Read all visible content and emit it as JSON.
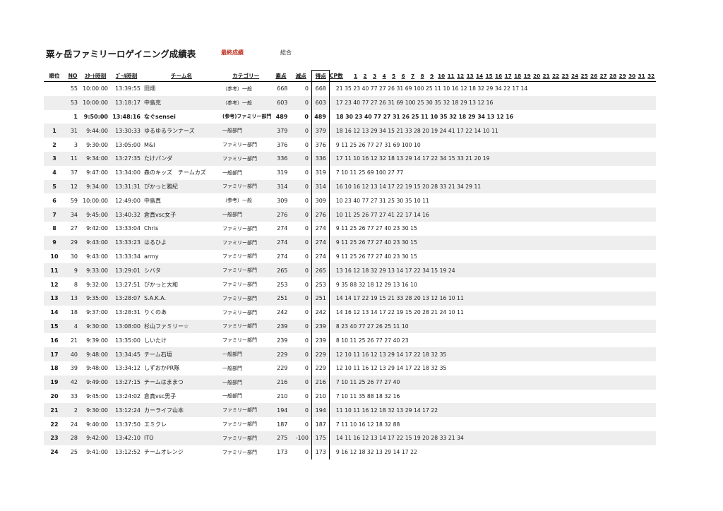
{
  "header": {
    "title": "粟ヶ岳ファミリーロゲイニング成績表",
    "label_final": "最終成績",
    "label_overall": "総合"
  },
  "columns": {
    "rank": "順位",
    "no": "NO",
    "start": "ｽﾀｰﾄ時刻",
    "goal": "ｺﾞｰﾙ時刻",
    "team": "チーム名",
    "category": "カテゴリー",
    "raw": "素点",
    "penalty": "減点",
    "score": "得点",
    "cp_count": "CP数",
    "cp_numbers": [
      "1",
      "2",
      "3",
      "4",
      "5",
      "6",
      "7",
      "8",
      "9",
      "10",
      "11",
      "12",
      "13",
      "14",
      "15",
      "16",
      "17",
      "18",
      "19",
      "20",
      "21",
      "22",
      "23",
      "24",
      "25",
      "26",
      "27",
      "28",
      "29",
      "30",
      "31",
      "32"
    ]
  },
  "rows": [
    {
      "rank": "",
      "no": "55",
      "start": "10:00:00",
      "goal": "13:39:55",
      "team": "田畑",
      "category": "（参考）一般",
      "raw": "668",
      "penalty": "0",
      "score": "668",
      "cps": "21 35 23 40 77 27 26 31 69 100 25 11 10 16 12 18 32 29 34 22 17 14",
      "bold": false
    },
    {
      "rank": "",
      "no": "53",
      "start": "10:00:00",
      "goal": "13:18:17",
      "team": "中島克",
      "category": "（参考）一般",
      "raw": "603",
      "penalty": "0",
      "score": "603",
      "cps": "17 23 40 77 27 26 31 69 100 25 30 35 32 18 29 13 12 16",
      "bold": false
    },
    {
      "rank": "",
      "no": "1",
      "start": "9:50:00",
      "goal": "13:48:16",
      "team": "なぐsensei",
      "category": "(参考)ファミリー部門",
      "raw": "489",
      "penalty": "0",
      "score": "489",
      "cps": "18 30 23 40 77 27 31 26 25 11 10 35 32 18 29 34 13 12 16",
      "bold": true
    },
    {
      "rank": "1",
      "no": "31",
      "start": "9:44:00",
      "goal": "13:30:33",
      "team": "ゆるゆるランナーズ",
      "category": "一般部門",
      "raw": "379",
      "penalty": "0",
      "score": "379",
      "cps": "18 16 12 13 29 34 15 21 33 28 20 19 24 41 17 22 14 10 11",
      "bold": false
    },
    {
      "rank": "2",
      "no": "3",
      "start": "9:30:00",
      "goal": "13:05:00",
      "team": "M&I",
      "category": "ファミリー部門",
      "raw": "376",
      "penalty": "0",
      "score": "376",
      "cps": "9 11 25 26 77 27 31 69 100 10",
      "bold": false
    },
    {
      "rank": "3",
      "no": "11",
      "start": "9:34:00",
      "goal": "13:27:35",
      "team": "たけパンダ",
      "category": "ファミリー部門",
      "raw": "336",
      "penalty": "0",
      "score": "336",
      "cps": "17 11 10 16 12 32 18 13 29 14 17 22 34 15 33 21 20 19",
      "bold": false
    },
    {
      "rank": "4",
      "no": "37",
      "start": "9:47:00",
      "goal": "13:34:00",
      "team": "森のキッズ　チームカズ",
      "category": "一般部門",
      "raw": "319",
      "penalty": "0",
      "score": "319",
      "cps": "7 10 11 25 69 100 27 77",
      "bold": false
    },
    {
      "rank": "5",
      "no": "12",
      "start": "9:34:00",
      "goal": "13:31:31",
      "team": "ぴかっと雅紀",
      "category": "ファミリー部門",
      "raw": "314",
      "penalty": "0",
      "score": "314",
      "cps": "16 10 16 12 13 14 17 22 19 15 20 28 33 21 34 29 11",
      "bold": false
    },
    {
      "rank": "6",
      "no": "59",
      "start": "10:00:00",
      "goal": "12:49:00",
      "team": "中島真",
      "category": "（参考）一般",
      "raw": "309",
      "penalty": "0",
      "score": "309",
      "cps": "10 23 40 77 27 31 25 30 35 10 11",
      "bold": false
    },
    {
      "rank": "7",
      "no": "34",
      "start": "9:45:00",
      "goal": "13:40:32",
      "team": "倉真vsc女子",
      "category": "一般部門",
      "raw": "276",
      "penalty": "0",
      "score": "276",
      "cps": "10 11 25 26 77 27 41 22 17 14 16",
      "bold": false
    },
    {
      "rank": "8",
      "no": "27",
      "start": "9:42:00",
      "goal": "13:33:04",
      "team": "Chris",
      "category": "ファミリー部門",
      "raw": "274",
      "penalty": "0",
      "score": "274",
      "cps": "9 11 25 26 77 27 40 23 30 15",
      "bold": false
    },
    {
      "rank": "9",
      "no": "29",
      "start": "9:43:00",
      "goal": "13:33:23",
      "team": "はるひよ",
      "category": "ファミリー部門",
      "raw": "274",
      "penalty": "0",
      "score": "274",
      "cps": "9 11 25 26 77 27 40 23 30 15",
      "bold": false
    },
    {
      "rank": "10",
      "no": "30",
      "start": "9:43:00",
      "goal": "13:33:34",
      "team": "army",
      "category": "ファミリー部門",
      "raw": "274",
      "penalty": "0",
      "score": "274",
      "cps": "9 11 25 26 77 27 40 23 30 15",
      "bold": false
    },
    {
      "rank": "11",
      "no": "9",
      "start": "9:33:00",
      "goal": "13:29:01",
      "team": "シバタ",
      "category": "ファミリー部門",
      "raw": "265",
      "penalty": "0",
      "score": "265",
      "cps": "13 16 12 18 32 29 13 14 17 22 34 15 19 24",
      "bold": false
    },
    {
      "rank": "12",
      "no": "8",
      "start": "9:32:00",
      "goal": "13:27:51",
      "team": "ぴかっと大和",
      "category": "ファミリー部門",
      "raw": "253",
      "penalty": "0",
      "score": "253",
      "cps": "9 35 88 32 18 12 29 13 16 10",
      "bold": false
    },
    {
      "rank": "13",
      "no": "13",
      "start": "9:35:00",
      "goal": "13:28:07",
      "team": "S.A.K.A.",
      "category": "ファミリー部門",
      "raw": "251",
      "penalty": "0",
      "score": "251",
      "cps": "14 14 17 22 19 15 21 33 28 20 13 12 16 10 11",
      "bold": false
    },
    {
      "rank": "14",
      "no": "18",
      "start": "9:37:00",
      "goal": "13:28:31",
      "team": "りくのあ",
      "category": "ファミリー部門",
      "raw": "242",
      "penalty": "0",
      "score": "242",
      "cps": "14 16 12 13 14 17 22 19 15 20 28 21 24 10 11",
      "bold": false
    },
    {
      "rank": "15",
      "no": "4",
      "start": "9:30:00",
      "goal": "13:08:00",
      "team": "杉山ファミリー☆",
      "category": "ファミリー部門",
      "raw": "239",
      "penalty": "0",
      "score": "239",
      "cps": "8 23 40 77 27 26 25 11 10",
      "bold": false
    },
    {
      "rank": "16",
      "no": "21",
      "start": "9:39:00",
      "goal": "13:35:00",
      "team": "しいたけ",
      "category": "ファミリー部門",
      "raw": "239",
      "penalty": "0",
      "score": "239",
      "cps": "8 10 11 25 26 77 27 40 23",
      "bold": false
    },
    {
      "rank": "17",
      "no": "40",
      "start": "9:48:00",
      "goal": "13:34:45",
      "team": "チーム石垣",
      "category": "一般部門",
      "raw": "229",
      "penalty": "0",
      "score": "229",
      "cps": "12 10 11 16 12 13 29 14 17 22 18 32 35",
      "bold": false
    },
    {
      "rank": "18",
      "no": "39",
      "start": "9:48:00",
      "goal": "13:34:12",
      "team": "しずおかPR隊",
      "category": "一般部門",
      "raw": "229",
      "penalty": "0",
      "score": "229",
      "cps": "12 10 11 16 12 13 29 14 17 22 18 32 35",
      "bold": false
    },
    {
      "rank": "19",
      "no": "42",
      "start": "9:49:00",
      "goal": "13:27:15",
      "team": "チームはままつ",
      "category": "一般部門",
      "raw": "216",
      "penalty": "0",
      "score": "216",
      "cps": "7 10 11 25 26 77 27 40",
      "bold": false
    },
    {
      "rank": "20",
      "no": "33",
      "start": "9:45:00",
      "goal": "13:24:02",
      "team": "倉真vsc男子",
      "category": "一般部門",
      "raw": "210",
      "penalty": "0",
      "score": "210",
      "cps": "7 10 11 35 88 18 32 16",
      "bold": false
    },
    {
      "rank": "21",
      "no": "2",
      "start": "9:30:00",
      "goal": "13:12:24",
      "team": "カーライフ山本",
      "category": "ファミリー部門",
      "raw": "194",
      "penalty": "0",
      "score": "194",
      "cps": "11 10 11 16 12 18 32 13 29 14 17 22",
      "bold": false
    },
    {
      "rank": "22",
      "no": "24",
      "start": "9:40:00",
      "goal": "13:37:50",
      "team": "エミクレ",
      "category": "ファミリー部門",
      "raw": "187",
      "penalty": "0",
      "score": "187",
      "cps": "7 11 10 16 12 18 32 88",
      "bold": false
    },
    {
      "rank": "23",
      "no": "28",
      "start": "9:42:00",
      "goal": "13:42:10",
      "team": "ITO",
      "category": "ファミリー部門",
      "raw": "275",
      "penalty": "-100",
      "score": "175",
      "cps": "14 11 16 12 13 14 17 22 15 19 20 28 33 21 34",
      "bold": false
    },
    {
      "rank": "24",
      "no": "25",
      "start": "9:41:00",
      "goal": "13:12:52",
      "team": "チームオレンジ",
      "category": "ファミリー部門",
      "raw": "173",
      "penalty": "0",
      "score": "173",
      "cps": "9 16 12 18 32 13 29 14 17 22",
      "bold": false
    }
  ]
}
